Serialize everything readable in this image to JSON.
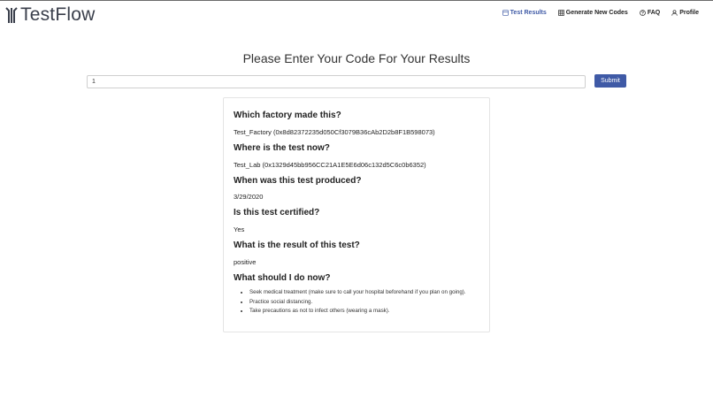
{
  "brand": {
    "name": "TestFlow"
  },
  "nav": {
    "items": [
      {
        "label": "Test Results",
        "icon": "results-icon",
        "active": true
      },
      {
        "label": "Generate New Codes",
        "icon": "grid-icon",
        "active": false
      },
      {
        "label": "FAQ",
        "icon": "help-circle-icon",
        "active": false
      },
      {
        "label": "Profile",
        "icon": "user-icon",
        "active": false
      }
    ]
  },
  "search": {
    "title": "Please Enter Your Code For Your Results",
    "value": "1",
    "submit_label": "Submit"
  },
  "results": {
    "factory_question": "Which factory made this?",
    "factory_answer": "Test_Factory (0x8d82372235d050Cf3079B36cAb2D2b8F1B598073)",
    "location_question": "Where is the test now?",
    "location_answer": "Test_Lab (0x1329d45bb956CC21A1E5E6d06c132d5C6c0b6352)",
    "produced_question": "When was this test produced?",
    "produced_answer": "3/29/2020",
    "certified_question": "Is this test certified?",
    "certified_answer": "Yes",
    "result_question": "What is the result of this test?",
    "result_answer": "positive",
    "advice_question": "What should I do now?",
    "advice": [
      "Seek medical treatment (make sure to call your hospital beforehand if you plan on going).",
      "Practice social distancing.",
      "Take precautions as not to infect others (wearing a mask)."
    ]
  },
  "colors": {
    "accent": "#3f5aa6",
    "text": "#222222",
    "border": "#e4e4e4"
  }
}
